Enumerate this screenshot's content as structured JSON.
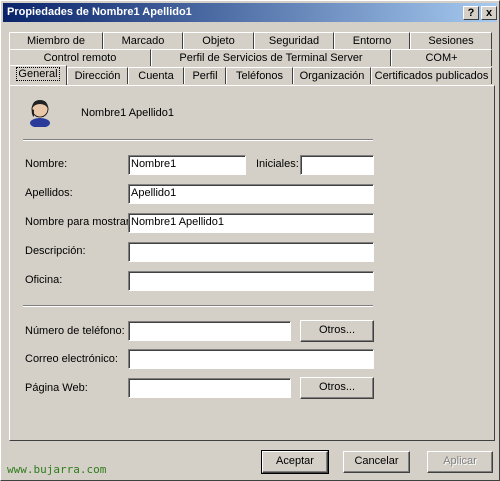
{
  "window": {
    "title": "Propiedades de Nombre1 Apellido1",
    "help_button": "?",
    "close_button": "x"
  },
  "tabs": {
    "row1": [
      "Miembro de",
      "Marcado",
      "Objeto",
      "Seguridad",
      "Entorno",
      "Sesiones"
    ],
    "row2": [
      "Control remoto",
      "Perfil de Servicios de Terminal Server",
      "COM+"
    ],
    "row3": [
      "General",
      "Dirección",
      "Cuenta",
      "Perfil",
      "Teléfonos",
      "Organización",
      "Certificados publicados"
    ],
    "active": "General"
  },
  "user": {
    "display": "Nombre1 Apellido1",
    "icon": "user-icon"
  },
  "form": {
    "nombre_label": "Nombre:",
    "nombre_value": "Nombre1",
    "iniciales_label": "Iniciales:",
    "iniciales_value": "",
    "apellidos_label": "Apellidos:",
    "apellidos_value": "Apellido1",
    "mostrar_label": "Nombre para mostrar:",
    "mostrar_value": "Nombre1 Apellido1",
    "descripcion_label": "Descripción:",
    "descripcion_value": "",
    "oficina_label": "Oficina:",
    "oficina_value": "",
    "telefono_label": "Número de teléfono:",
    "telefono_value": "",
    "telefono_otros": "Otros...",
    "correo_label": "Correo electrónico:",
    "correo_value": "",
    "web_label": "Página Web:",
    "web_value": "",
    "web_otros": "Otros..."
  },
  "buttons": {
    "accept": "Aceptar",
    "cancel": "Cancelar",
    "apply": "Aplicar"
  },
  "watermark": "www.bujarra.com"
}
